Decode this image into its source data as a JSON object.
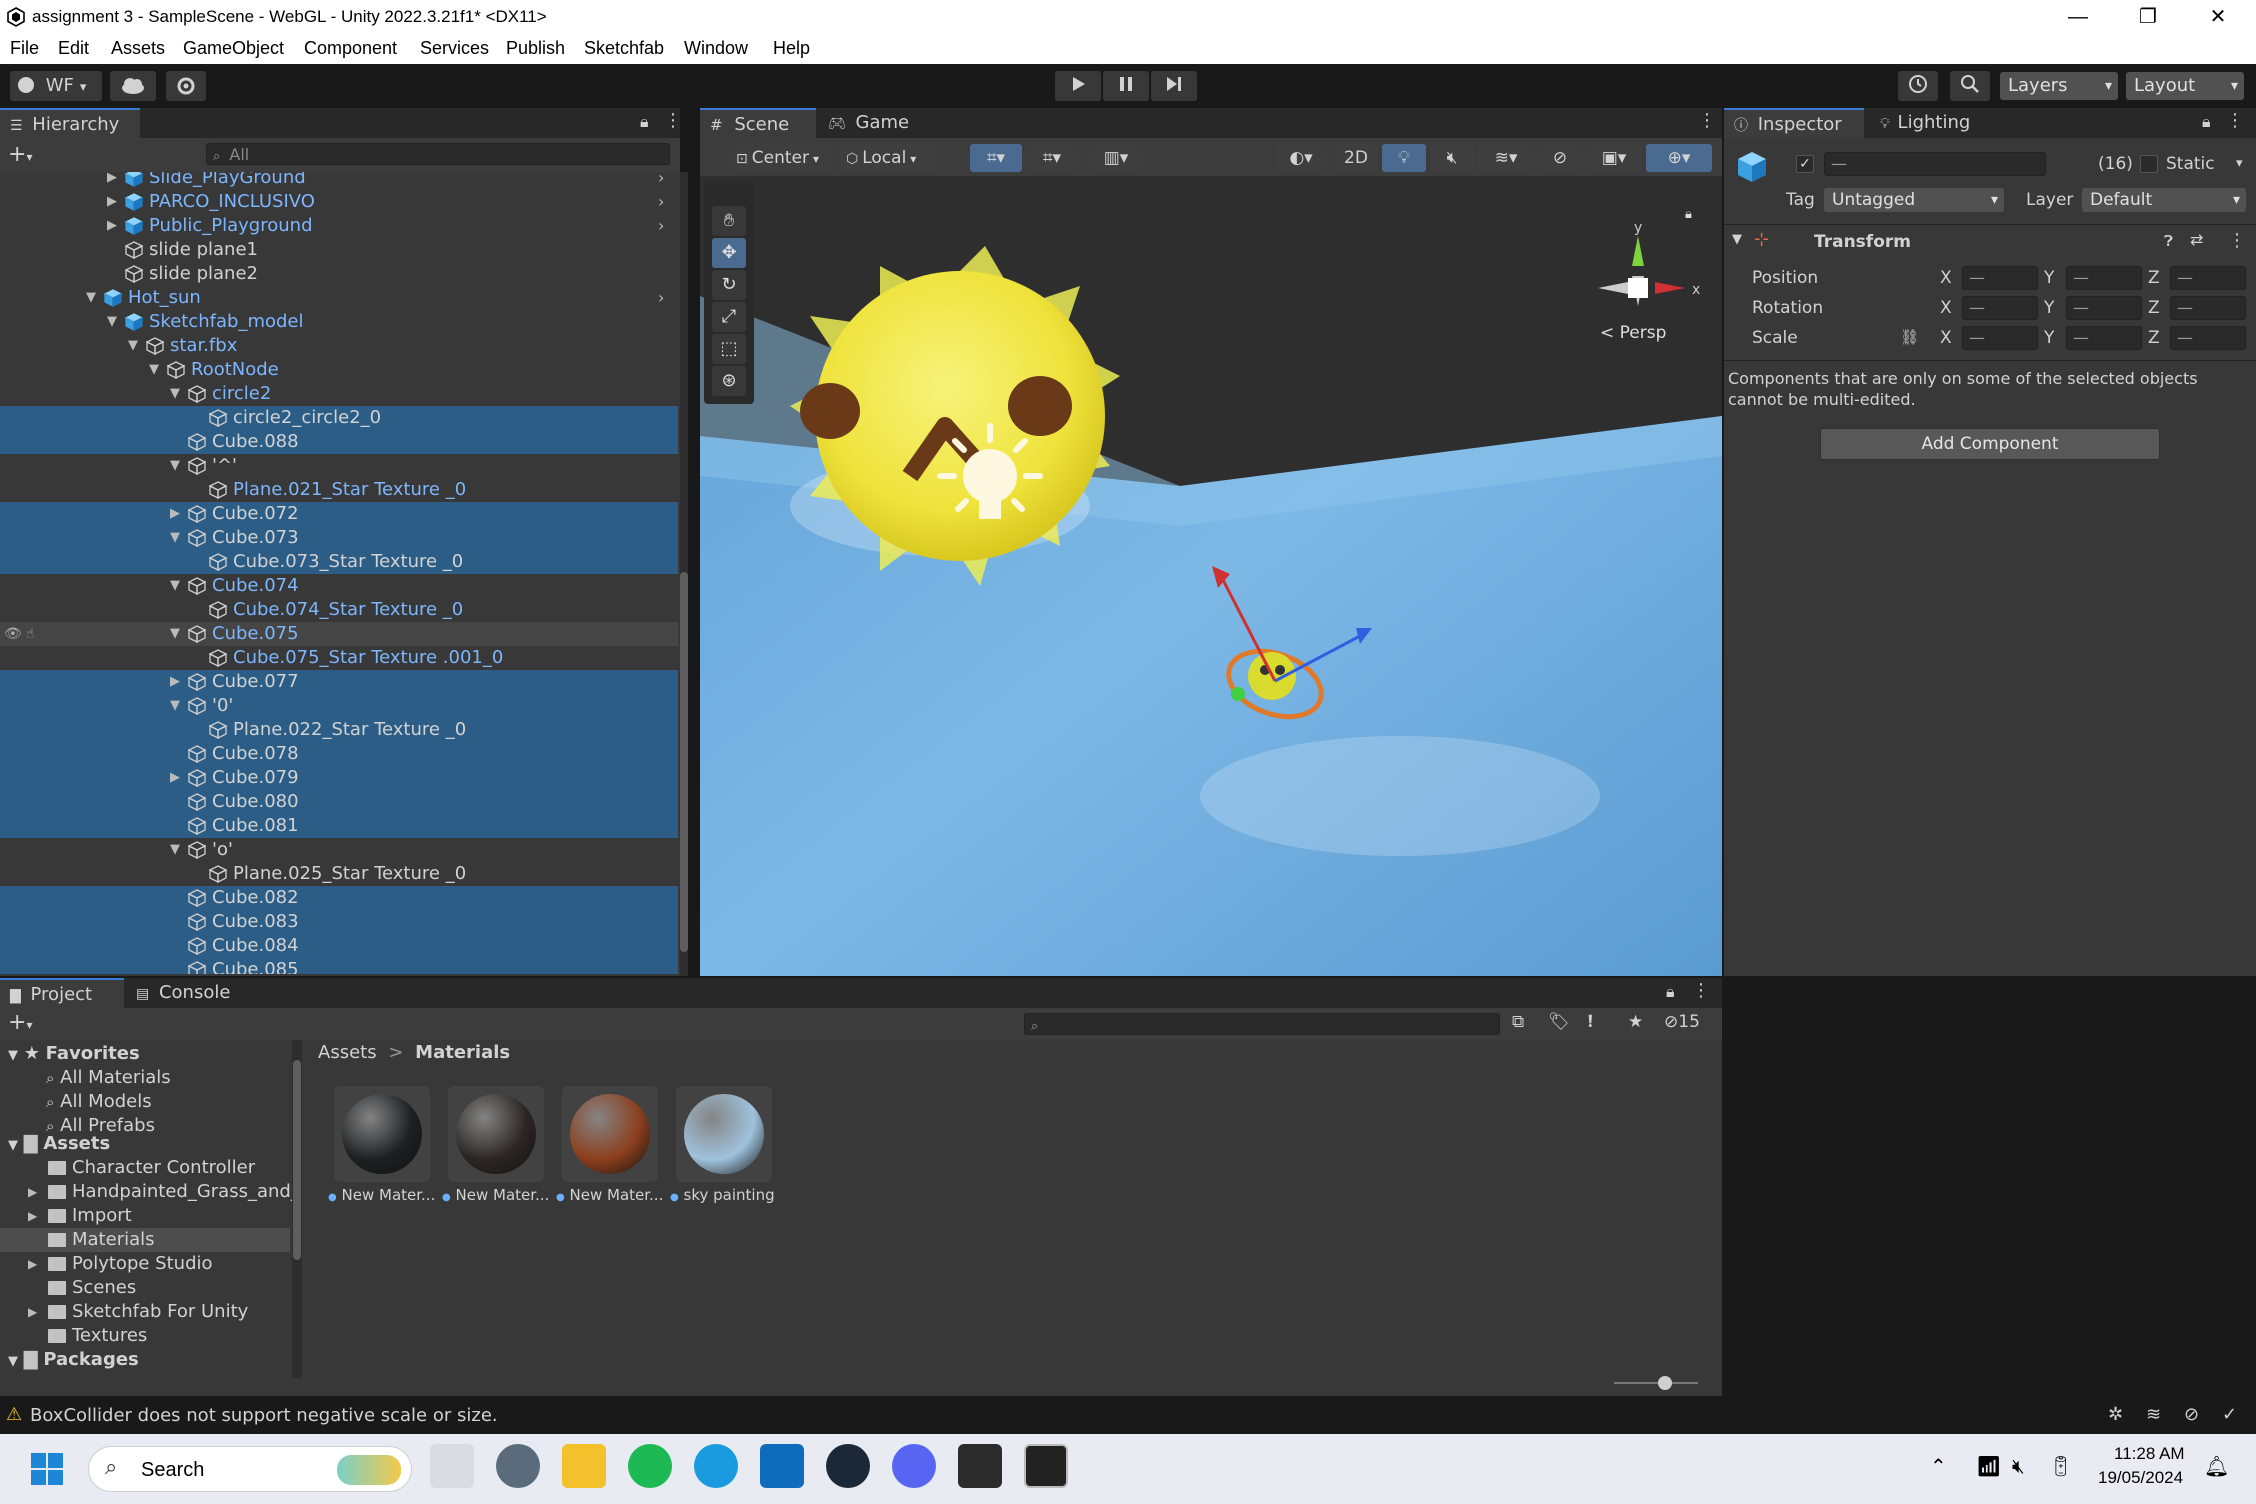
{
  "window": {
    "title": "assignment 3 - SampleScene - WebGL - Unity 2022.3.21f1* <DX11>",
    "min": "—",
    "max": "❐",
    "close": "✕"
  },
  "menu": [
    "File",
    "Edit",
    "Assets",
    "GameObject",
    "Component",
    "Services",
    "Publish",
    "Sketchfab",
    "Window",
    "Help"
  ],
  "toolbar": {
    "account": "WF",
    "layers": "Layers",
    "layout": "Layout"
  },
  "hierarchy": {
    "tab": "Hierarchy",
    "search_placeholder": "All",
    "rows": [
      {
        "label": "Slide_PlayGround",
        "indent": 1,
        "arrow": "▶",
        "prefab": true,
        "sel": false
      },
      {
        "label": "PARCO_INCLUSIVO",
        "indent": 1,
        "arrow": "▶",
        "prefab": true,
        "sel": false
      },
      {
        "label": "Public_Playground",
        "indent": 1,
        "arrow": "▶",
        "prefab": true,
        "sel": false
      },
      {
        "label": "slide plane1",
        "indent": 1,
        "arrow": "",
        "prefab": false,
        "sel": false
      },
      {
        "label": "slide plane2",
        "indent": 1,
        "arrow": "",
        "prefab": false,
        "sel": false
      },
      {
        "label": "Hot_sun",
        "indent": 0,
        "arrow": "▼",
        "prefab": true,
        "sel": false
      },
      {
        "label": "Sketchfab_model",
        "indent": 1,
        "arrow": "▼",
        "prefab": true,
        "sel": false
      },
      {
        "label": "star.fbx",
        "indent": 2,
        "arrow": "▼",
        "prefab": true,
        "sel": false
      },
      {
        "label": "RootNode",
        "indent": 3,
        "arrow": "▼",
        "prefab": true,
        "sel": false
      },
      {
        "label": "circle2",
        "indent": 4,
        "arrow": "▼",
        "prefab": true,
        "sel": false
      },
      {
        "label": "circle2_circle2_0",
        "indent": 5,
        "arrow": "",
        "prefab": false,
        "sel": true
      },
      {
        "label": "Cube.088",
        "indent": 4,
        "arrow": "",
        "prefab": false,
        "sel": true
      },
      {
        "label": "'^'",
        "indent": 4,
        "arrow": "▼",
        "prefab": false,
        "sel": false
      },
      {
        "label": "Plane.021_Star Texture _0",
        "indent": 5,
        "arrow": "",
        "prefab": true,
        "sel": false
      },
      {
        "label": "Cube.072",
        "indent": 4,
        "arrow": "▶",
        "prefab": false,
        "sel": true
      },
      {
        "label": "Cube.073",
        "indent": 4,
        "arrow": "▼",
        "prefab": false,
        "sel": true
      },
      {
        "label": "Cube.073_Star Texture _0",
        "indent": 5,
        "arrow": "",
        "prefab": false,
        "sel": true
      },
      {
        "label": "Cube.074",
        "indent": 4,
        "arrow": "▼",
        "prefab": true,
        "sel": false
      },
      {
        "label": "Cube.074_Star Texture _0",
        "indent": 5,
        "arrow": "",
        "prefab": true,
        "sel": false
      },
      {
        "label": "Cube.075",
        "indent": 4,
        "arrow": "▼",
        "prefab": true,
        "sel": false,
        "hov": true
      },
      {
        "label": "Cube.075_Star Texture .001_0",
        "indent": 5,
        "arrow": "",
        "prefab": true,
        "sel": false
      },
      {
        "label": "Cube.077",
        "indent": 4,
        "arrow": "▶",
        "prefab": false,
        "sel": true
      },
      {
        "label": "'0'",
        "indent": 4,
        "arrow": "▼",
        "prefab": false,
        "sel": true
      },
      {
        "label": "Plane.022_Star Texture _0",
        "indent": 5,
        "arrow": "",
        "prefab": false,
        "sel": true
      },
      {
        "label": "Cube.078",
        "indent": 4,
        "arrow": "",
        "prefab": false,
        "sel": true
      },
      {
        "label": "Cube.079",
        "indent": 4,
        "arrow": "▶",
        "prefab": false,
        "sel": true
      },
      {
        "label": "Cube.080",
        "indent": 4,
        "arrow": "",
        "prefab": false,
        "sel": true
      },
      {
        "label": "Cube.081",
        "indent": 4,
        "arrow": "",
        "prefab": false,
        "sel": true
      },
      {
        "label": "'o'",
        "indent": 4,
        "arrow": "▼",
        "prefab": false,
        "sel": false
      },
      {
        "label": "Plane.025_Star Texture _0",
        "indent": 5,
        "arrow": "",
        "prefab": false,
        "sel": false
      },
      {
        "label": "Cube.082",
        "indent": 4,
        "arrow": "",
        "prefab": false,
        "sel": true
      },
      {
        "label": "Cube.083",
        "indent": 4,
        "arrow": "",
        "prefab": false,
        "sel": true
      },
      {
        "label": "Cube.084",
        "indent": 4,
        "arrow": "",
        "prefab": false,
        "sel": true
      },
      {
        "label": "Cube.085",
        "indent": 4,
        "arrow": "",
        "prefab": false,
        "sel": true
      }
    ]
  },
  "scene": {
    "tab_scene": "Scene",
    "tab_game": "Game",
    "pivot": "Center",
    "space": "Local",
    "mode_2d": "2D",
    "persp": "< Persp",
    "axis_y": "y",
    "axis_x": "x"
  },
  "inspector": {
    "tab": "Inspector",
    "tab_lighting": "Lighting",
    "name_value": "—",
    "count": "(16)",
    "static_label": "Static",
    "tag_label": "Tag",
    "tag_value": "Untagged",
    "layer_label": "Layer",
    "layer_value": "Default",
    "transform_title": "Transform",
    "position_label": "Position",
    "rotation_label": "Rotation",
    "scale_label": "Scale",
    "axis_x": "X",
    "axis_y": "Y",
    "axis_z": "Z",
    "mixed": "—",
    "note": "Components that are only on some of the selected objects cannot be multi-edited.",
    "add_component": "Add Component"
  },
  "project": {
    "tab_project": "Project",
    "tab_console": "Console",
    "favorites_label": "Favorites",
    "favorites": [
      "All Materials",
      "All Models",
      "All Prefabs"
    ],
    "assets_label": "Assets",
    "folders": [
      {
        "label": "Character Controller",
        "arrow": ""
      },
      {
        "label": "Handpainted_Grass_and_",
        "arrow": "▶"
      },
      {
        "label": "Import",
        "arrow": "▶"
      },
      {
        "label": "Materials",
        "arrow": "",
        "sel": true
      },
      {
        "label": "Polytope Studio",
        "arrow": "▶"
      },
      {
        "label": "Scenes",
        "arrow": ""
      },
      {
        "label": "Sketchfab For Unity",
        "arrow": "▶"
      },
      {
        "label": "Textures",
        "arrow": ""
      }
    ],
    "packages_label": "Packages",
    "breadcrumb_root": "Assets",
    "breadcrumb_sep": ">",
    "breadcrumb_current": "Materials",
    "hidden_count": "15",
    "assets": [
      {
        "name": "New Mater...",
        "color": "#1e1f22"
      },
      {
        "name": "New Mater...",
        "color": "#2c2623"
      },
      {
        "name": "New Mater...",
        "color": "#8c3f1d"
      },
      {
        "name": "sky painting",
        "color": "#9fc2dc"
      }
    ]
  },
  "status": {
    "message": "BoxCollider does not support negative scale or size."
  },
  "taskbar": {
    "search": "Search",
    "time": "11:28 AM",
    "date": "19/05/2024"
  }
}
